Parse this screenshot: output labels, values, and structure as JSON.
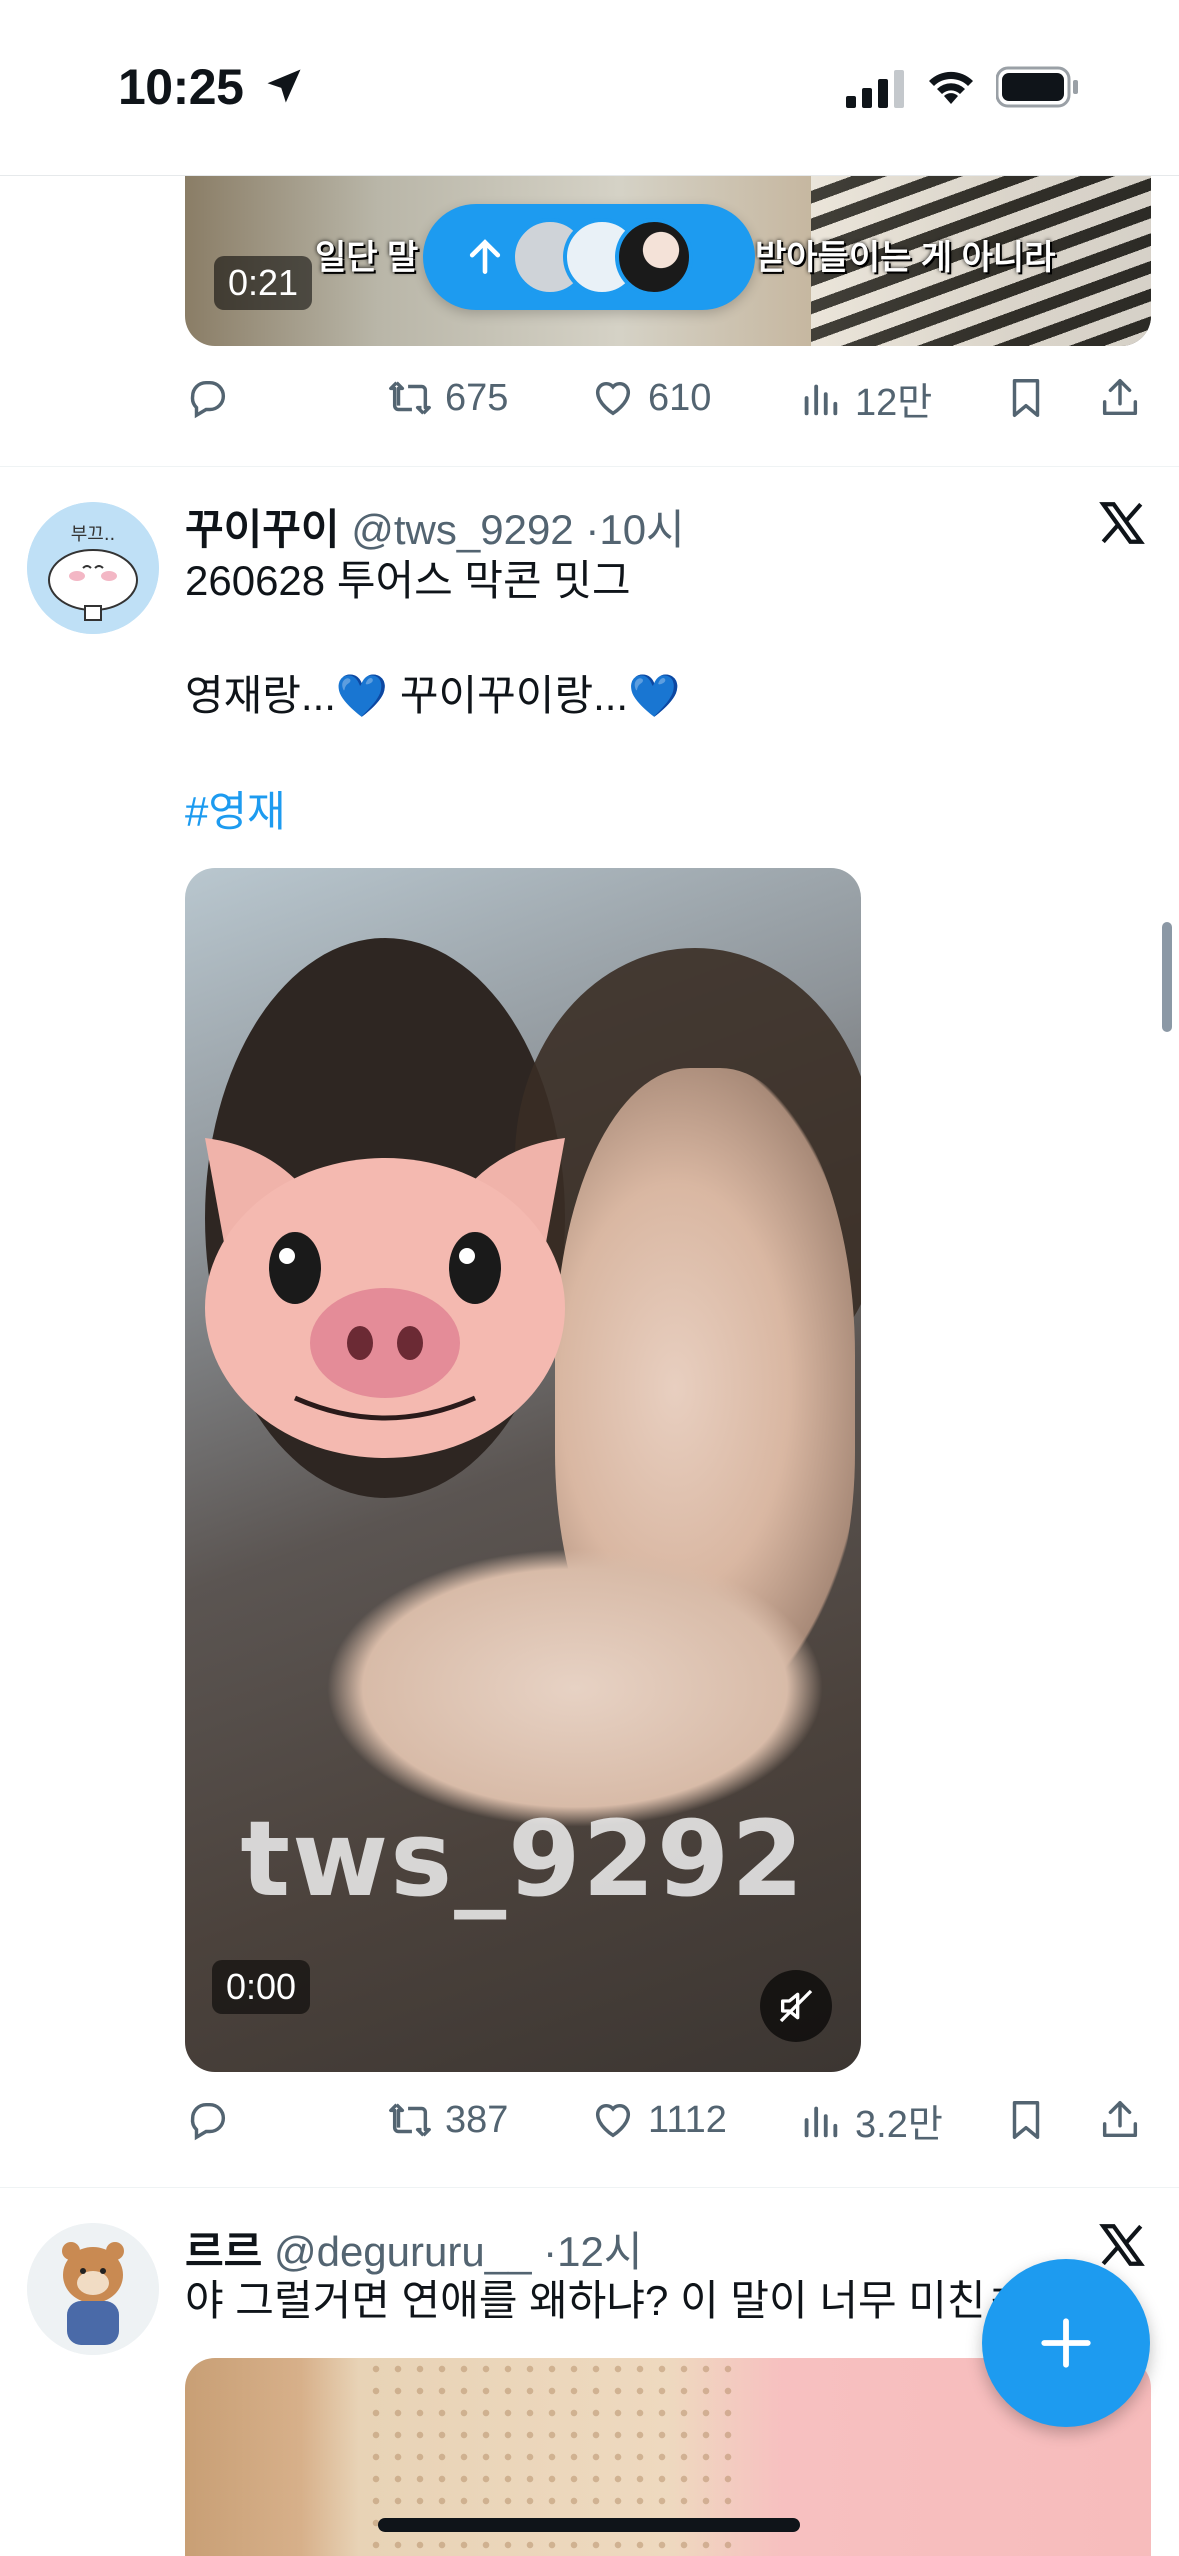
{
  "status_bar": {
    "time": "10:25"
  },
  "tweets": [
    {
      "media": {
        "duration": "0:21",
        "subtitle_left": "일단 말",
        "subtitle_right": "받아들이는 게 아니라"
      },
      "stats": {
        "retweets": "675",
        "likes": "610",
        "views": "12만"
      }
    },
    {
      "name": "꾸이꾸이",
      "handle": "@tws_9292",
      "sep": "·",
      "time": "10시",
      "avatar_text": "부끄..",
      "text_line1": "260628 투어스 막콘 밋그",
      "text_line2": "영재랑...💙 꾸이꾸이랑...💙",
      "hashtag": "#영재",
      "media": {
        "duration": "0:00",
        "watermark": "tws_9292"
      },
      "stats": {
        "retweets": "387",
        "likes": "1112",
        "views": "3.2만"
      }
    },
    {
      "name": "르르",
      "handle": "@degururu__",
      "sep": "·",
      "time": "12시",
      "text_line1": "야 그럴거면 연애를 왜하냐? 이 말이 너무 미친ㅋ"
    }
  ],
  "colors": {
    "accent": "#1d9bf0",
    "secondary_text": "#536471",
    "primary_text": "#0f1419"
  },
  "icons": [
    "location-arrow-icon",
    "signal-icon",
    "wifi-icon",
    "battery-icon",
    "reply-icon",
    "retweet-icon",
    "like-icon",
    "views-icon",
    "bookmark-icon",
    "share-icon",
    "x-logo-icon",
    "mute-icon",
    "compose-plus-icon",
    "arrow-up-icon"
  ]
}
